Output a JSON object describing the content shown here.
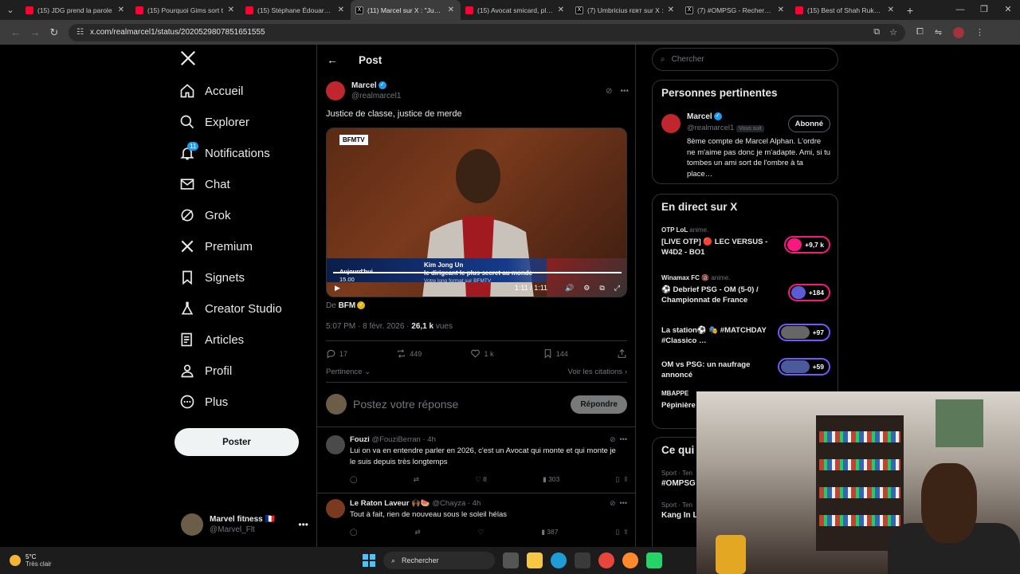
{
  "browser": {
    "tabs": [
      {
        "title": "(15) JDG prend la parole",
        "kind": "yt",
        "active": false
      },
      {
        "title": "(15) Pourquoi Gims sort t",
        "kind": "yt",
        "active": false
      },
      {
        "title": "(15) Stéphane Édouard : C",
        "kind": "yt",
        "active": false
      },
      {
        "title": "(11) Marcel sur X : \"Justic",
        "kind": "x",
        "active": true
      },
      {
        "title": "(15) Avocat smicard, plon",
        "kind": "yt",
        "active": false
      },
      {
        "title": "(7) Umbricius ғᴇʀᴛ sur X :",
        "kind": "x",
        "active": false
      },
      {
        "title": "(7) #OMPSG - Recherche",
        "kind": "x",
        "active": false
      },
      {
        "title": "(15) Best of Shah Rukh K",
        "kind": "yt",
        "active": false
      }
    ],
    "url": "x.com/realmarcel1/status/2020529807851651555"
  },
  "nav": {
    "items": [
      {
        "label": "Accueil",
        "icon": "home-icon"
      },
      {
        "label": "Explorer",
        "icon": "search-icon"
      },
      {
        "label": "Notifications",
        "icon": "bell-icon",
        "badge": "11"
      },
      {
        "label": "Chat",
        "icon": "mail-icon"
      },
      {
        "label": "Grok",
        "icon": "grok-icon"
      },
      {
        "label": "Premium",
        "icon": "x-logo-icon"
      },
      {
        "label": "Signets",
        "icon": "bookmark-icon"
      },
      {
        "label": "Creator Studio",
        "icon": "flask-icon"
      },
      {
        "label": "Articles",
        "icon": "article-icon"
      },
      {
        "label": "Profil",
        "icon": "person-icon"
      },
      {
        "label": "Plus",
        "icon": "more-circle-icon"
      }
    ],
    "post_button": "Poster",
    "me": {
      "name": "Marvel fitness 🇫🇷",
      "handle": "@Marvel_Flt"
    }
  },
  "post": {
    "header_title": "Post",
    "author_name": "Marcel",
    "author_handle": "@realmarcel1",
    "text": "Justice de classe, justice de merde",
    "video": {
      "channel": "BFMTV",
      "lower_left_1": "Aujourd'hui",
      "lower_left_2": "15.00",
      "lower_right_1": "Kim Jong Un",
      "lower_right_2": "le dirigeant le plus secret au monde",
      "lower_right_3": "Votre long format sur BFMTV",
      "time": "1:11 / 1:11"
    },
    "from_label": "De",
    "from_name": "BFM",
    "time": "5:07 PM · 8 févr. 2026 · ",
    "views_count": "26,1 k",
    "views_label": " vues",
    "stats": {
      "replies": "17",
      "reposts": "449",
      "likes": "1 k",
      "bookmarks": "144"
    },
    "sort_label": "Pertinence",
    "quotes_label": "Voir les citations",
    "reply_placeholder": "Postez votre réponse",
    "reply_button": "Répondre"
  },
  "replies": [
    {
      "name": "Fouzi",
      "handle": "@FouziBerran · 4h",
      "text": "Lui on va en entendre parler en 2026, c'est un Avocat qui monte et qui monte je le suis depuis très longtemps",
      "likes": "8",
      "views": "303"
    },
    {
      "name": "Le Raton Laveur 🙌🏾🍉",
      "handle": "@Chayza · 4h",
      "text": "Tout à fait, rien de nouveau sous le soleil hélas",
      "likes": "",
      "views": "387"
    }
  ],
  "sidebar": {
    "search_placeholder": "Chercher",
    "relevant": {
      "title": "Personnes pertinentes",
      "name": "Marcel",
      "handle": "@realmarcel1",
      "follows_you": "Vous suit",
      "button": "Abonné",
      "bio": "8ème compte de Marcel Alphan. L'ordre ne m'aime pas donc je m'adapte. Ami, si tu tombes un ami sort de l'ombre à ta place…"
    },
    "live": {
      "title": "En direct sur X",
      "items": [
        {
          "who": "OTP LoL",
          "sub": "anime.",
          "title": "[LIVE OTP] 🔴 LEC VERSUS - W4D2 - BO1",
          "count": "+9,7 k"
        },
        {
          "who": "Winamax FC 🔞",
          "sub": "anime.",
          "title": "⚽ Debrief PSG - OM (5-0) / Championnat de France",
          "count": "+184"
        },
        {
          "who": "",
          "sub": "",
          "title": "La station⚽ 🎭 #MATCHDAY #Classico …",
          "count": "+97"
        },
        {
          "who": "",
          "sub": "",
          "title": "OM vs PSG: un naufrage annoncé",
          "count": "+59"
        },
        {
          "who": "MBAPPE",
          "sub": "",
          "title": "Pépinière",
          "count": ""
        }
      ]
    },
    "trends": {
      "title": "Ce qui",
      "items": [
        {
          "cat": "Sport · Ten",
          "title": "#OMPSG"
        },
        {
          "cat": "Sport · Ten",
          "title": "Kang In L"
        }
      ]
    }
  },
  "taskbar": {
    "temp": "5°C",
    "weather": "Très clair",
    "search": "Rechercher"
  }
}
